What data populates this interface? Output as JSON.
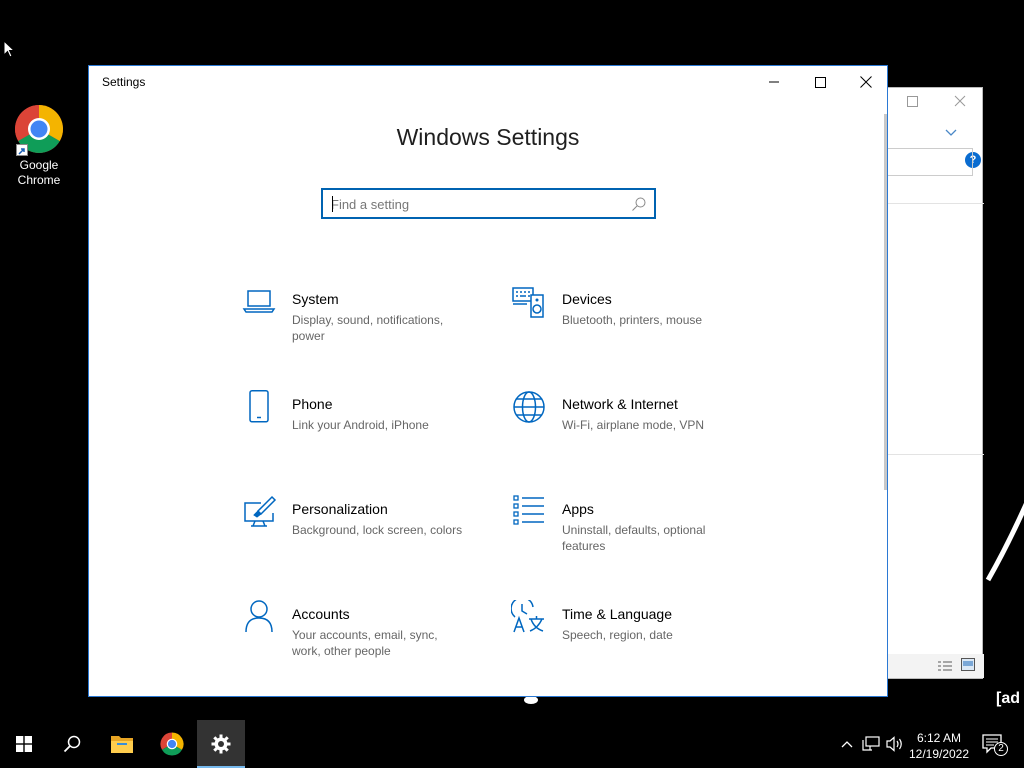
{
  "desktop": {
    "icons": [
      {
        "label": "Google Chrome"
      }
    ]
  },
  "background_window": {
    "help_label": "?"
  },
  "overlay_text": "[ad",
  "settings_window": {
    "title": "Settings",
    "heading": "Windows Settings",
    "search": {
      "placeholder": "Find a setting",
      "value": ""
    },
    "categories": [
      {
        "title": "System",
        "description": "Display, sound, notifications, power",
        "icon": "laptop-icon"
      },
      {
        "title": "Devices",
        "description": "Bluetooth, printers, mouse",
        "icon": "keyboard-speaker-icon"
      },
      {
        "title": "Phone",
        "description": "Link your Android, iPhone",
        "icon": "phone-icon"
      },
      {
        "title": "Network & Internet",
        "description": "Wi-Fi, airplane mode, VPN",
        "icon": "globe-icon"
      },
      {
        "title": "Personalization",
        "description": "Background, lock screen, colors",
        "icon": "paint-monitor-icon"
      },
      {
        "title": "Apps",
        "description": "Uninstall, defaults, optional features",
        "icon": "apps-list-icon"
      },
      {
        "title": "Accounts",
        "description": "Your accounts, email, sync, work, other people",
        "icon": "person-icon"
      },
      {
        "title": "Time & Language",
        "description": "Speech, region, date",
        "icon": "time-language-icon"
      }
    ]
  },
  "taskbar": {
    "apps": [
      "start-icon",
      "search-icon",
      "file-explorer-icon",
      "chrome-icon",
      "settings-icon"
    ],
    "active_app": "settings-icon",
    "clock": {
      "time": "6:12 AM",
      "date": "12/19/2022"
    },
    "notification_count": "2"
  },
  "colors": {
    "accent": "#0063b1",
    "icon_blue": "#0067c0",
    "window_border": "#2b79d4"
  }
}
